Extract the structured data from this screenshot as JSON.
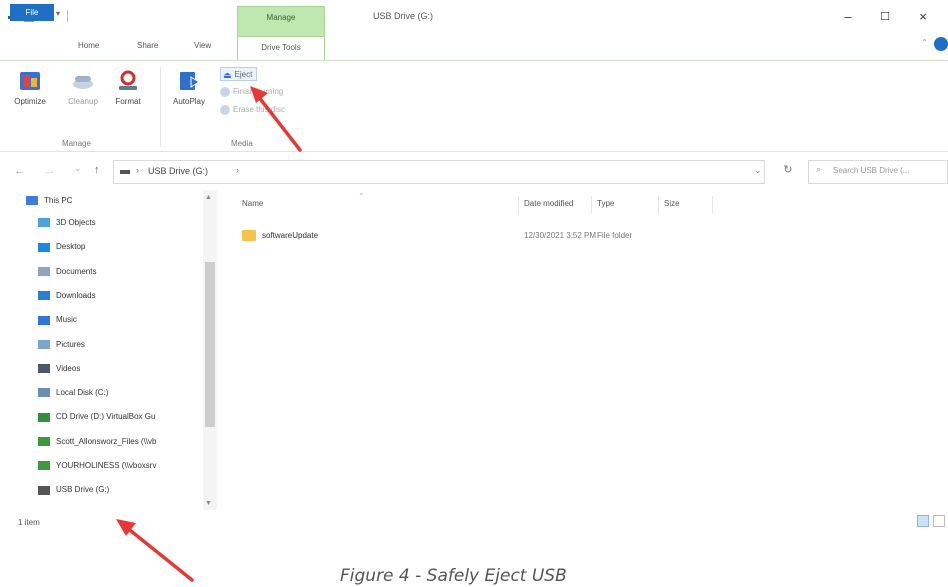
{
  "titlebar": {
    "context_tab_label": "Manage",
    "window_title": "USB Drive (G:)",
    "minimize_glyph": "–",
    "maximize_glyph": "☐",
    "close_glyph": "×"
  },
  "tabs": {
    "file": "File",
    "home": "Home",
    "share": "Share",
    "view": "View",
    "drive_tools": "Drive Tools"
  },
  "ribbon": {
    "manage_group": {
      "label": "Manage",
      "optimize": "Optimize",
      "cleanup": "Cleanup",
      "format": "Format"
    },
    "media_group": {
      "label": "Media",
      "autoplay": "AutoPlay",
      "eject": "Eject",
      "finish_burning": "Finish burning",
      "erase_this_disc": "Erase this disc"
    }
  },
  "navigation": {
    "back_glyph": "←",
    "forward_glyph": "→",
    "recent_glyph": "⌄",
    "up_glyph": "↑",
    "address_path": "USB Drive (G:)",
    "address_chevron": "›",
    "dropdown_glyph": "⌄",
    "refresh_glyph": "↻",
    "search_placeholder": "Search USB Drive (..."
  },
  "nav_pane": {
    "items": [
      {
        "label": "This PC",
        "icon": "computer-icon",
        "color": "#3b7dd8"
      },
      {
        "label": "3D Objects",
        "icon": "cube-icon",
        "color": "#4aa3df"
      },
      {
        "label": "Desktop",
        "icon": "desktop-icon",
        "color": "#1e88e5"
      },
      {
        "label": "Documents",
        "icon": "document-icon",
        "color": "#8ea4bf"
      },
      {
        "label": "Downloads",
        "icon": "download-icon",
        "color": "#2b7fd4"
      },
      {
        "label": "Music",
        "icon": "music-icon",
        "color": "#2d7ad6"
      },
      {
        "label": "Pictures",
        "icon": "pictures-icon",
        "color": "#7aa6d1"
      },
      {
        "label": "Videos",
        "icon": "video-icon",
        "color": "#4b5a6b"
      },
      {
        "label": "Local Disk (C:)",
        "icon": "disk-icon",
        "color": "#6b8fb3"
      },
      {
        "label": "CD Drive (D:) VirtualBox Gu",
        "icon": "cd-icon",
        "color": "#2f8f3a"
      },
      {
        "label": "Scott_Allonsworz_Files (\\\\vb",
        "icon": "network-drive-icon",
        "color": "#3c9a3c"
      },
      {
        "label": "YOURHOLINESS (\\\\vboxsrv",
        "icon": "network-drive-icon",
        "color": "#3c9a3c"
      },
      {
        "label": "USB Drive (G:)",
        "icon": "usb-drive-icon",
        "color": "#555555"
      }
    ]
  },
  "content": {
    "columns": [
      "Name",
      "Date modified",
      "Type",
      "Size"
    ],
    "rows": [
      {
        "name": "softwareUpdate",
        "date": "12/30/2021 3:52 PM",
        "type": "File folder",
        "size": ""
      }
    ]
  },
  "status": {
    "item_count": "1 item"
  },
  "caption": "Figure 4 - Safely Eject USB",
  "colors": {
    "accent": "#1f6fc5",
    "context_green": "#bfe7b0",
    "arrow_red": "#e53935",
    "folder_yellow": "#f5c34a"
  }
}
